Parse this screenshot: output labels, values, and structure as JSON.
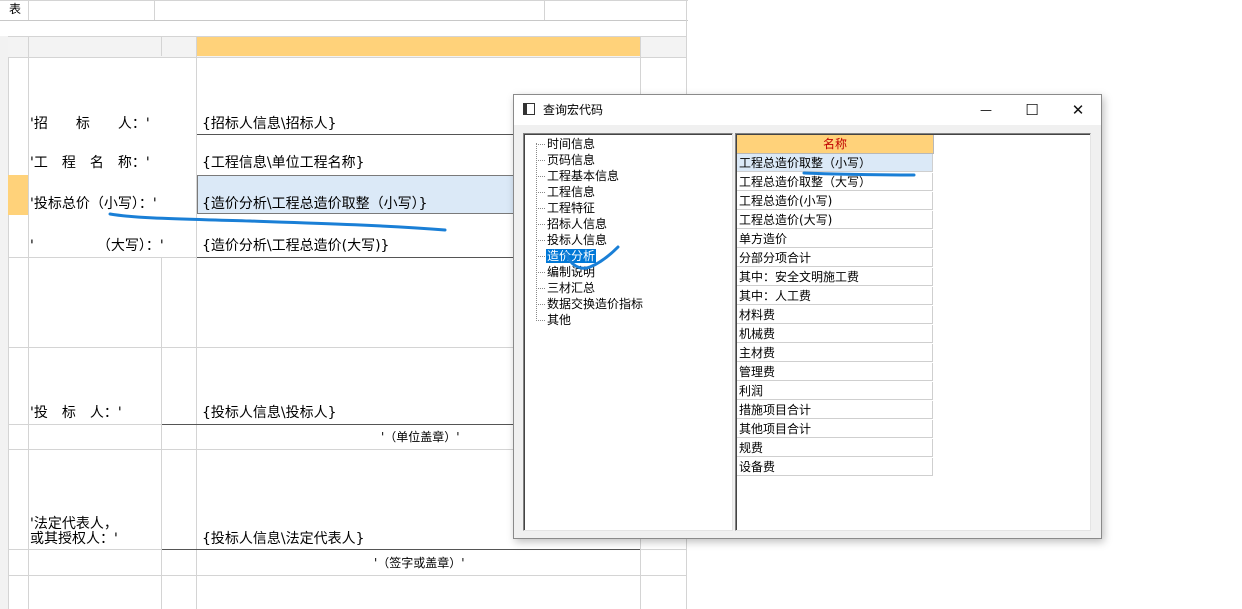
{
  "sheet": {
    "corner_label": "表",
    "row_marker": "➜",
    "labels": {
      "tender_person": "'招　　标　　人：'",
      "project_name": "'工　程　名　称：'",
      "bid_total_small": "'投标总价（小写）：'",
      "bid_total_big": "'　　　　　（大写）：'",
      "bidder": "'投　标　人：'",
      "unit_seal": "'（单位盖章）'",
      "legal_rep_line1": "'法定代表人，",
      "legal_rep_line2": "或其授权人：'",
      "sign_seal": "'（签字或盖章）'"
    },
    "values": {
      "tender_person": "{招标人信息\\招标人}",
      "project_name": "{工程信息\\单位工程名称}",
      "bid_total_small": "{造价分析\\工程总造价取整（小写）}",
      "bid_total_big": "{造价分析\\工程总造价(大写)}",
      "bidder": "{投标人信息\\投标人}",
      "legal_rep": "{投标人信息\\法定代表人}"
    }
  },
  "dialog": {
    "title": "查询宏代码",
    "minimize": "—",
    "maximize": "☐",
    "close": "✕",
    "tree_items": [
      "时间信息",
      "页码信息",
      "工程基本信息",
      "工程信息",
      "工程特征",
      "招标人信息",
      "投标人信息",
      "造价分析",
      "编制说明",
      "三材汇总",
      "数据交换造价指标",
      "其他"
    ],
    "tree_selected_index": 7,
    "grid_header": "名称",
    "grid_rows": [
      "工程总造价取整（小写）",
      "工程总造价取整（大写）",
      "工程总造价(小写)",
      "工程总造价(大写)",
      "单方造价",
      "分部分项合计",
      "其中：安全文明施工费",
      "其中：人工费",
      "材料费",
      "机械费",
      "主材费",
      "管理费",
      "利润",
      "措施项目合计",
      "其他项目合计",
      "规费",
      "设备费"
    ],
    "grid_selected_index": 0
  },
  "colors": {
    "header_orange": "#ffd27a",
    "selected_blue": "#dbe9f7",
    "tree_select": "#0078d7",
    "pen_blue": "#1a7fd6"
  }
}
